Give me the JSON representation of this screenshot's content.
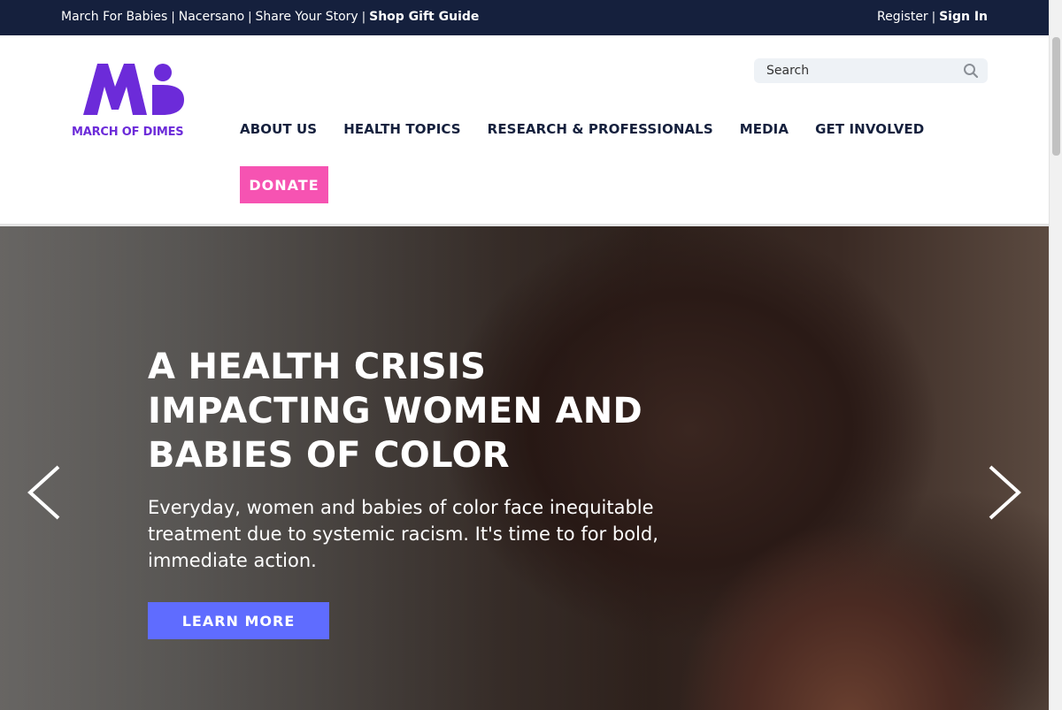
{
  "topbar": {
    "links": [
      "March For Babies",
      "Nacersano",
      "Share Your Story",
      "Shop Gift Guide"
    ],
    "separator": "|",
    "register": "Register",
    "sign_in": "Sign In"
  },
  "header": {
    "logo_text": "MARCH OF DIMES",
    "search_placeholder": "Search",
    "nav": [
      "ABOUT US",
      "HEALTH TOPICS",
      "RESEARCH & PROFESSIONALS",
      "MEDIA",
      "GET INVOLVED"
    ],
    "donate": "DONATE"
  },
  "hero": {
    "headline": "A HEALTH CRISIS IMPACTING WOMEN AND BABIES OF COLOR",
    "body": "Everyday, women and babies of color face inequitable treatment due to systemic racism. It's time to for bold, immediate action.",
    "cta": "LEARN MORE"
  },
  "colors": {
    "topbar_bg": "#15203d",
    "brand_purple": "#6c2bd9",
    "donate_pink": "#f653b2",
    "cta_blue": "#5f6cff"
  },
  "icons": [
    "search-icon",
    "chevron-left-icon",
    "chevron-right-icon"
  ]
}
